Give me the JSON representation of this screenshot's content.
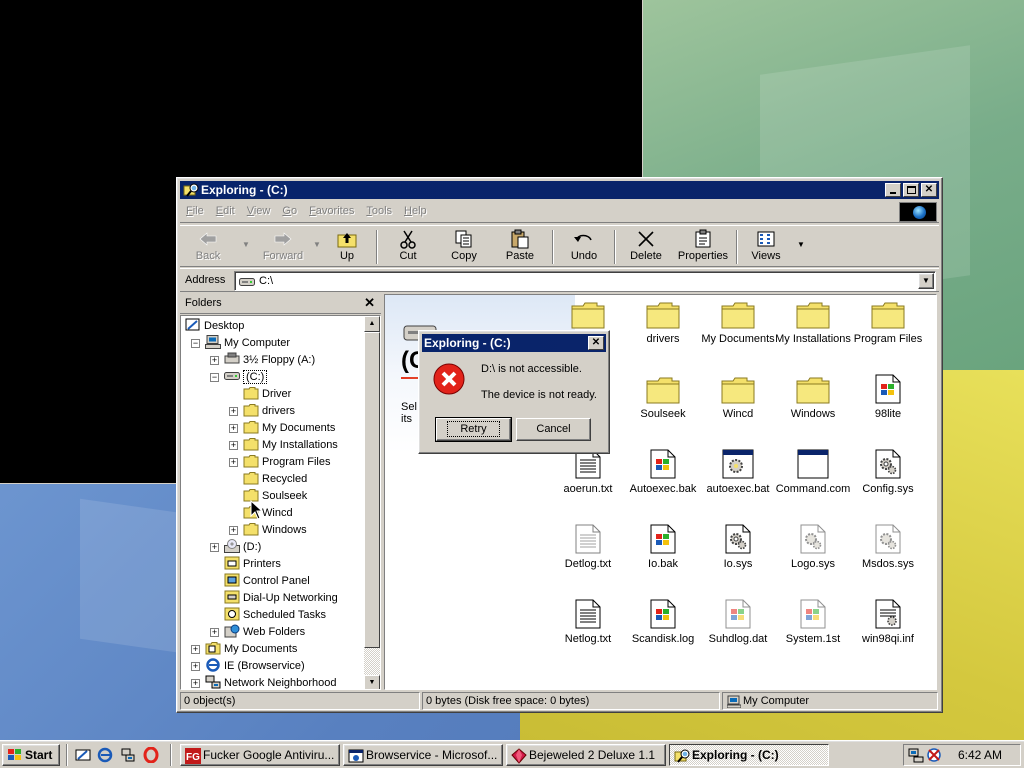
{
  "explorer": {
    "title": "Exploring -  (C:)",
    "menu": [
      "File",
      "Edit",
      "View",
      "Go",
      "Favorites",
      "Tools",
      "Help"
    ],
    "toolbar": {
      "back": "Back",
      "forward": "Forward",
      "up": "Up",
      "cut": "Cut",
      "copy": "Copy",
      "paste": "Paste",
      "undo": "Undo",
      "delete": "Delete",
      "properties": "Properties",
      "views": "Views"
    },
    "address": {
      "label": "Address",
      "value": "C:\\"
    },
    "folders": {
      "header": "Folders",
      "tree": [
        "Desktop",
        "My Computer",
        "3½ Floppy (A:)",
        "(C:)",
        "Driver",
        "drivers",
        "My Documents",
        "My Installations",
        "Program Files",
        "Recycled",
        "Soulseek",
        "Wincd",
        "Windows",
        "(D:)",
        "Printers",
        "Control Panel",
        "Dial-Up Networking",
        "Scheduled Tasks",
        "Web Folders",
        "My Documents",
        "IE (Browservice)",
        "Network Neighborhood"
      ]
    },
    "content": {
      "web_title": "(C",
      "web_info_line1": "Sel",
      "web_info_line2": "its",
      "files": [
        "drivers",
        "My Documents",
        "My Installations",
        "Program Files",
        "Soulseek",
        "Wincd",
        "Windows",
        "98lite",
        "aoerun.txt",
        "Autoexec.bak",
        "autoexec.bat",
        "Command.com",
        "Config.sys",
        "Detlog.txt",
        "Io.bak",
        "Io.sys",
        "Logo.sys",
        "Msdos.sys",
        "Netlog.txt",
        "Scandisk.log",
        "Suhdlog.dat",
        "System.1st",
        "win98qi.inf"
      ]
    },
    "status": {
      "objects": "0 object(s)",
      "bytes": "0 bytes (Disk free space: 0 bytes)",
      "location": "My Computer"
    }
  },
  "dialog": {
    "title": "Exploring -  (C:)",
    "message1": "D:\\ is not accessible.",
    "message2": "The device is not ready.",
    "retry": "Retry",
    "cancel": "Cancel"
  },
  "taskbar": {
    "start": "Start",
    "tasks": [
      "Fucker Google Antiviru...",
      "Browservice - Microsof...",
      "Bejeweled 2 Deluxe 1.1",
      "Exploring -  (C:)"
    ],
    "clock": "6:42 AM"
  },
  "colors": {
    "titlebar_active": "#0a246a",
    "face": "#d4d0c8",
    "error_red": "#e2231a",
    "folder_yellow": "#f4e06a"
  }
}
